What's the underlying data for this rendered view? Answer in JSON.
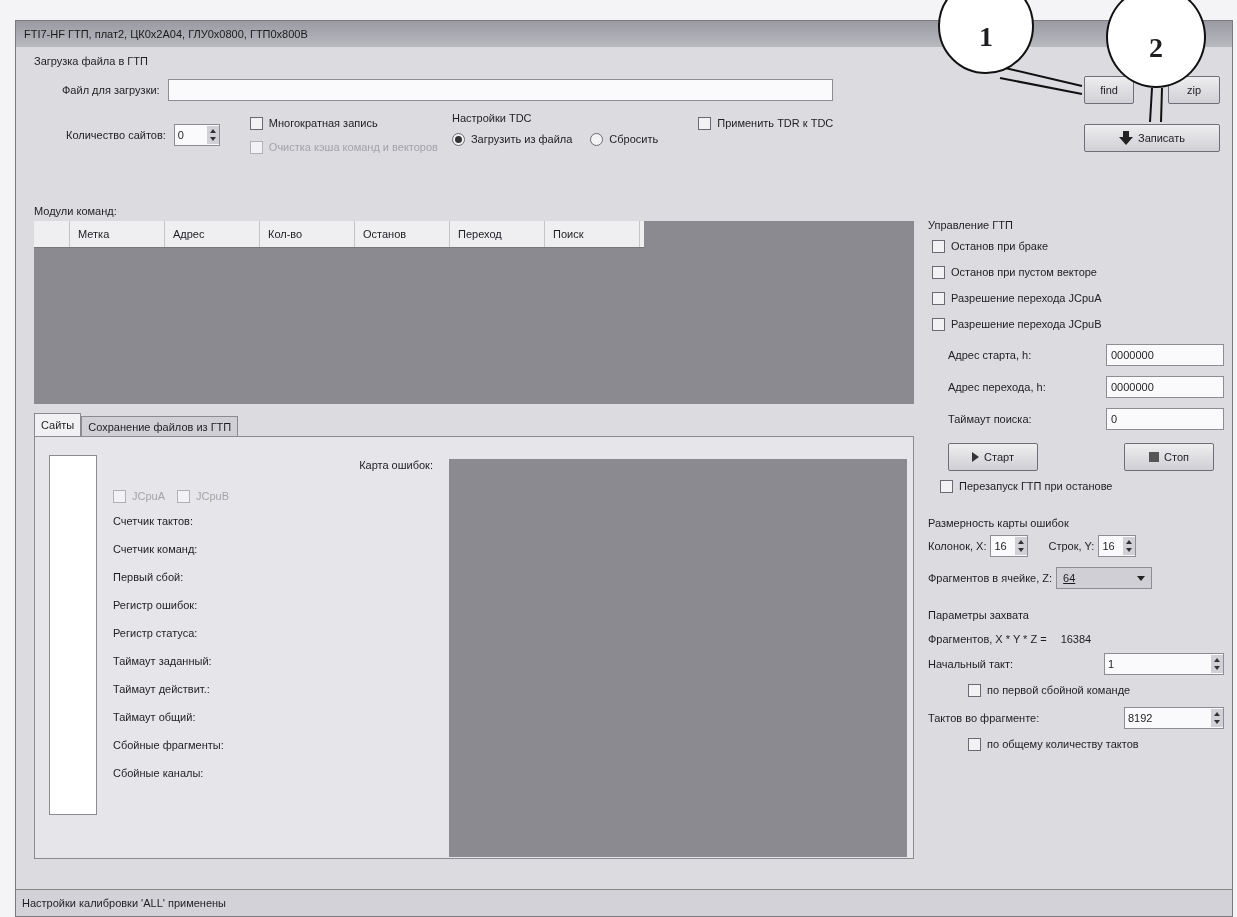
{
  "window": {
    "title": "FTI7-HF ГТП, плат2, ЦК0x2A04, ГЛУ0x0800, ГТП0x800B"
  },
  "upload": {
    "title": "Загрузка файла в ГТП",
    "file_label": "Файл для загрузки:",
    "find_button": "find",
    "zip_button": "zip",
    "sites_label": "Количество сайтов:",
    "sites_value": "0",
    "options": [
      {
        "label": "Многократная запись",
        "checked": false,
        "disabled": false
      },
      {
        "label": "Очистка кэша команд и векторов",
        "checked": false,
        "disabled": true
      }
    ],
    "tdc": {
      "title": "Настройки TDC",
      "radios": [
        {
          "label": "Загрузить из файла",
          "selected": true
        },
        {
          "label": "Сбросить",
          "selected": false
        }
      ]
    },
    "apply_tdr": {
      "label": "Применить TDR к TDC",
      "checked": false
    },
    "write_button": "Записать"
  },
  "modules": {
    "label": "Модули команд:",
    "columns": [
      "Метка",
      "Адрес",
      "Кол-во",
      "Останов",
      "Переход",
      "Поиск"
    ]
  },
  "tabs": [
    {
      "label": "Сайты",
      "selected": true
    },
    {
      "label": "Сохранение файлов из ГТП",
      "selected": false
    }
  ],
  "sites_panel": {
    "flags": [
      {
        "label": "JCpuA",
        "checked": false,
        "disabled": true
      },
      {
        "label": "JCpuB",
        "checked": false,
        "disabled": true
      }
    ],
    "fields": [
      "Счетчик тактов:",
      "Счетчик команд:",
      "Первый сбой:",
      "Регистр ошибок:",
      "Регистр статуса:",
      "Таймаут заданный:",
      "Таймаут действит.:",
      "Таймаут общий:",
      "Сбойные фрагменты:",
      "Сбойные каналы:"
    ],
    "error_map_label": "Карта ошибок:"
  },
  "control": {
    "title": "Управление ГТП",
    "checks": [
      {
        "label": "Останов при браке",
        "checked": false
      },
      {
        "label": "Останов при пустом векторе",
        "checked": false
      },
      {
        "label": "Разрешение перехода JCpuA",
        "checked": false
      },
      {
        "label": "Разрешение перехода JCpuB",
        "checked": false
      }
    ],
    "fields": [
      {
        "label": "Адрес старта, h:",
        "value": "0000000"
      },
      {
        "label": "Адрес перехода, h:",
        "value": "0000000"
      },
      {
        "label": "Таймаут поиска:",
        "value": "0"
      }
    ],
    "start_button": "Старт",
    "stop_button": "Стоп",
    "restart": {
      "label": "Перезапуск ГТП при останове",
      "checked": false
    }
  },
  "map_size": {
    "title": "Размерность карты ошибок",
    "columns": {
      "label": "Колонок, X:",
      "value": "16"
    },
    "rows": {
      "label": "Строк, Y:",
      "value": "16"
    },
    "fragments": {
      "label": "Фрагментов в ячейке, Z:",
      "value": "64"
    }
  },
  "capture": {
    "title": "Параметры захвата",
    "total_label": "Фрагментов, X * Y * Z =",
    "total_value": "16384",
    "start": {
      "label": "Начальный такт:",
      "value": "1"
    },
    "start_check": {
      "label": "по первой сбойной команде",
      "checked": false
    },
    "ticks": {
      "label": "Тактов во фрагменте:",
      "value": "8192"
    },
    "ticks_check": {
      "label": "по общему количеству тактов",
      "checked": false
    }
  },
  "status_bar": {
    "message": "Настройки калибровки 'ALL' применены"
  },
  "callouts": [
    {
      "number": "1"
    },
    {
      "number": "2"
    }
  ]
}
